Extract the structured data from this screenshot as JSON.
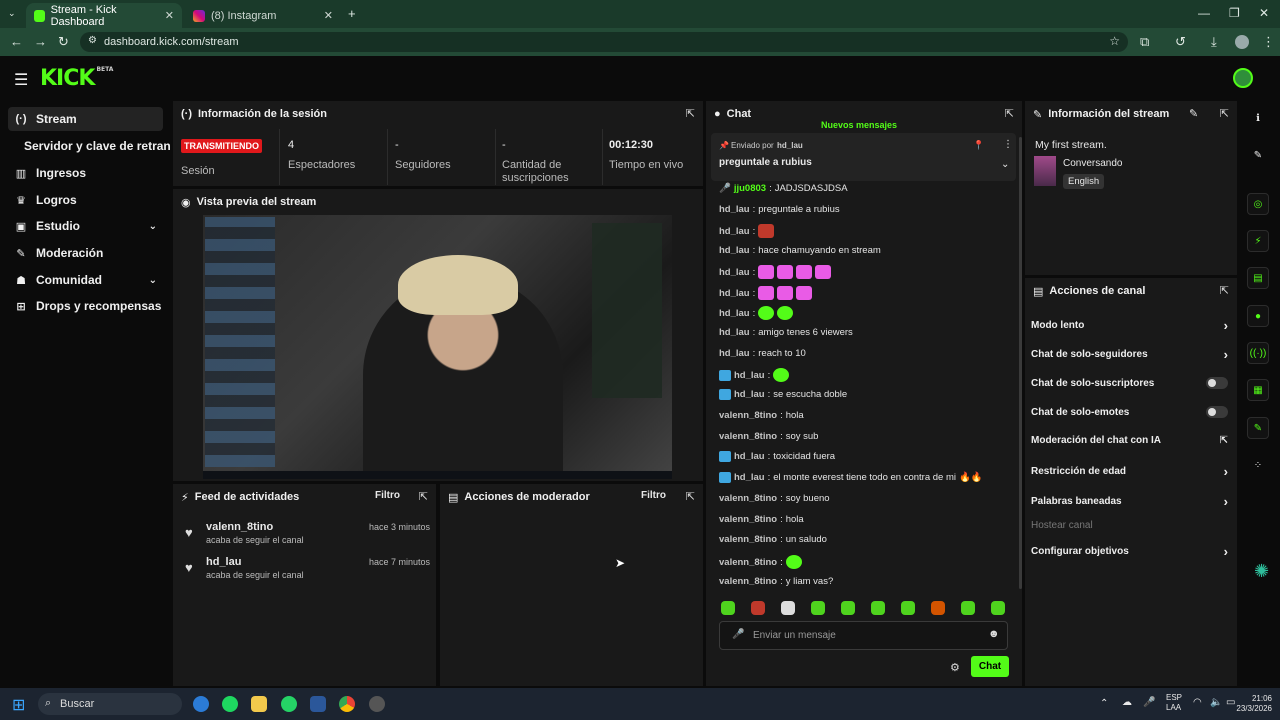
{
  "browser": {
    "tabs": [
      {
        "label": "Stream - Kick Dashboard",
        "active": true
      },
      {
        "label": "(8) Instagram",
        "active": false
      }
    ],
    "url": "dashboard.kick.com/stream"
  },
  "kick": {
    "logo": "KICK",
    "logo_beta": "BETA"
  },
  "sidebar": {
    "items": [
      {
        "label": "Stream",
        "icon": "broadcast-icon"
      },
      {
        "label": "Servidor y clave de retransmi",
        "icon": ""
      },
      {
        "label": "Ingresos",
        "icon": "chart-icon"
      },
      {
        "label": "Logros",
        "icon": "trophy-icon"
      },
      {
        "label": "Estudio",
        "icon": "studio-icon"
      },
      {
        "label": "Moderación",
        "icon": "shield-icon"
      },
      {
        "label": "Comunidad",
        "icon": "users-icon"
      },
      {
        "label": "Drops y recompensas",
        "icon": "gift-icon"
      }
    ]
  },
  "session": {
    "title": "Información de la sesión",
    "status_badge": "TRANSMITIENDO",
    "status_label": "Sesión",
    "stats": [
      {
        "value": "4",
        "label": "Espectadores"
      },
      {
        "value": "-",
        "label": "Seguidores"
      },
      {
        "value": "-",
        "label": "Cantidad de suscripciones"
      },
      {
        "value": "00:12:30",
        "label": "Tiempo en vivo"
      }
    ]
  },
  "preview": {
    "title": "Vista previa del stream"
  },
  "activity": {
    "title": "Feed de actividades",
    "filter": "Filtro",
    "items": [
      {
        "user": "valenn_8tino",
        "time": "hace 3 minutos",
        "text": "acaba de seguir el canal"
      },
      {
        "user": "hd_lau",
        "time": "hace 7 minutos",
        "text": "acaba de seguir el canal"
      }
    ]
  },
  "modactions": {
    "title": "Acciones de moderador",
    "filter": "Filtro"
  },
  "chat": {
    "title": "Chat",
    "new_messages": "Nuevos mensajes",
    "pinned_by": "Enviado por",
    "pinned_user": "hd_lau",
    "pinned_text": "preguntale a rubius",
    "messages": [
      {
        "user": "jju0803",
        "text": "JADJSDASJDSA"
      },
      {
        "user": "hd_lau",
        "text": "preguntale a rubius"
      },
      {
        "user": "hd_lau",
        "text": ""
      },
      {
        "user": "hd_lau",
        "text": "hace chamuyando en stream"
      },
      {
        "user": "hd_lau",
        "text": ""
      },
      {
        "user": "hd_lau",
        "text": ""
      },
      {
        "user": "hd_lau",
        "text": ""
      },
      {
        "user": "hd_lau",
        "text": "amigo tenes 6 viewers"
      },
      {
        "user": "hd_lau",
        "text": "reach to 10"
      },
      {
        "user": "hd_lau",
        "text": ""
      },
      {
        "user": "hd_lau",
        "text": "se escucha doble"
      },
      {
        "user": "valenn_8tino",
        "text": "hola"
      },
      {
        "user": "valenn_8tino",
        "text": "soy sub"
      },
      {
        "user": "hd_lau",
        "text": "toxicidad fuera"
      },
      {
        "user": "hd_lau",
        "text": "el monte everest tiene todo en contra de mi"
      },
      {
        "user": "valenn_8tino",
        "text": "soy bueno"
      },
      {
        "user": "valenn_8tino",
        "text": "hola"
      },
      {
        "user": "valenn_8tino",
        "text": "un saludo"
      },
      {
        "user": "valenn_8tino",
        "text": ""
      },
      {
        "user": "valenn_8tino",
        "text": "y liam vas?"
      }
    ],
    "input_placeholder": "Enviar un mensaje",
    "send_label": "Chat"
  },
  "stream_info": {
    "title": "Información del stream",
    "stream_title": "My first stream.",
    "category": "Conversando",
    "language": "English"
  },
  "channel_actions": {
    "title": "Acciones de canal",
    "items": [
      {
        "label": "Modo lento",
        "control": "arrow"
      },
      {
        "label": "Chat de solo-seguidores",
        "control": "arrow"
      },
      {
        "label": "Chat de solo-suscriptores",
        "control": "toggle"
      },
      {
        "label": "Chat de solo-emotes",
        "control": "toggle"
      },
      {
        "label": "Moderación del chat con IA",
        "control": "external"
      },
      {
        "label": "Restricción de edad",
        "control": "arrow"
      },
      {
        "label": "Palabras baneadas",
        "control": "arrow"
      },
      {
        "label": "Hostear canal",
        "control": "none"
      },
      {
        "label": "Configurar objetivos",
        "control": "arrow"
      }
    ]
  },
  "taskbar": {
    "search": "Buscar",
    "lang": "ESP",
    "lang2": "LAA",
    "time": "21:06",
    "date": "23/3/2026"
  },
  "colors": {
    "accent": "#53fc18",
    "live": "#e0181b"
  }
}
